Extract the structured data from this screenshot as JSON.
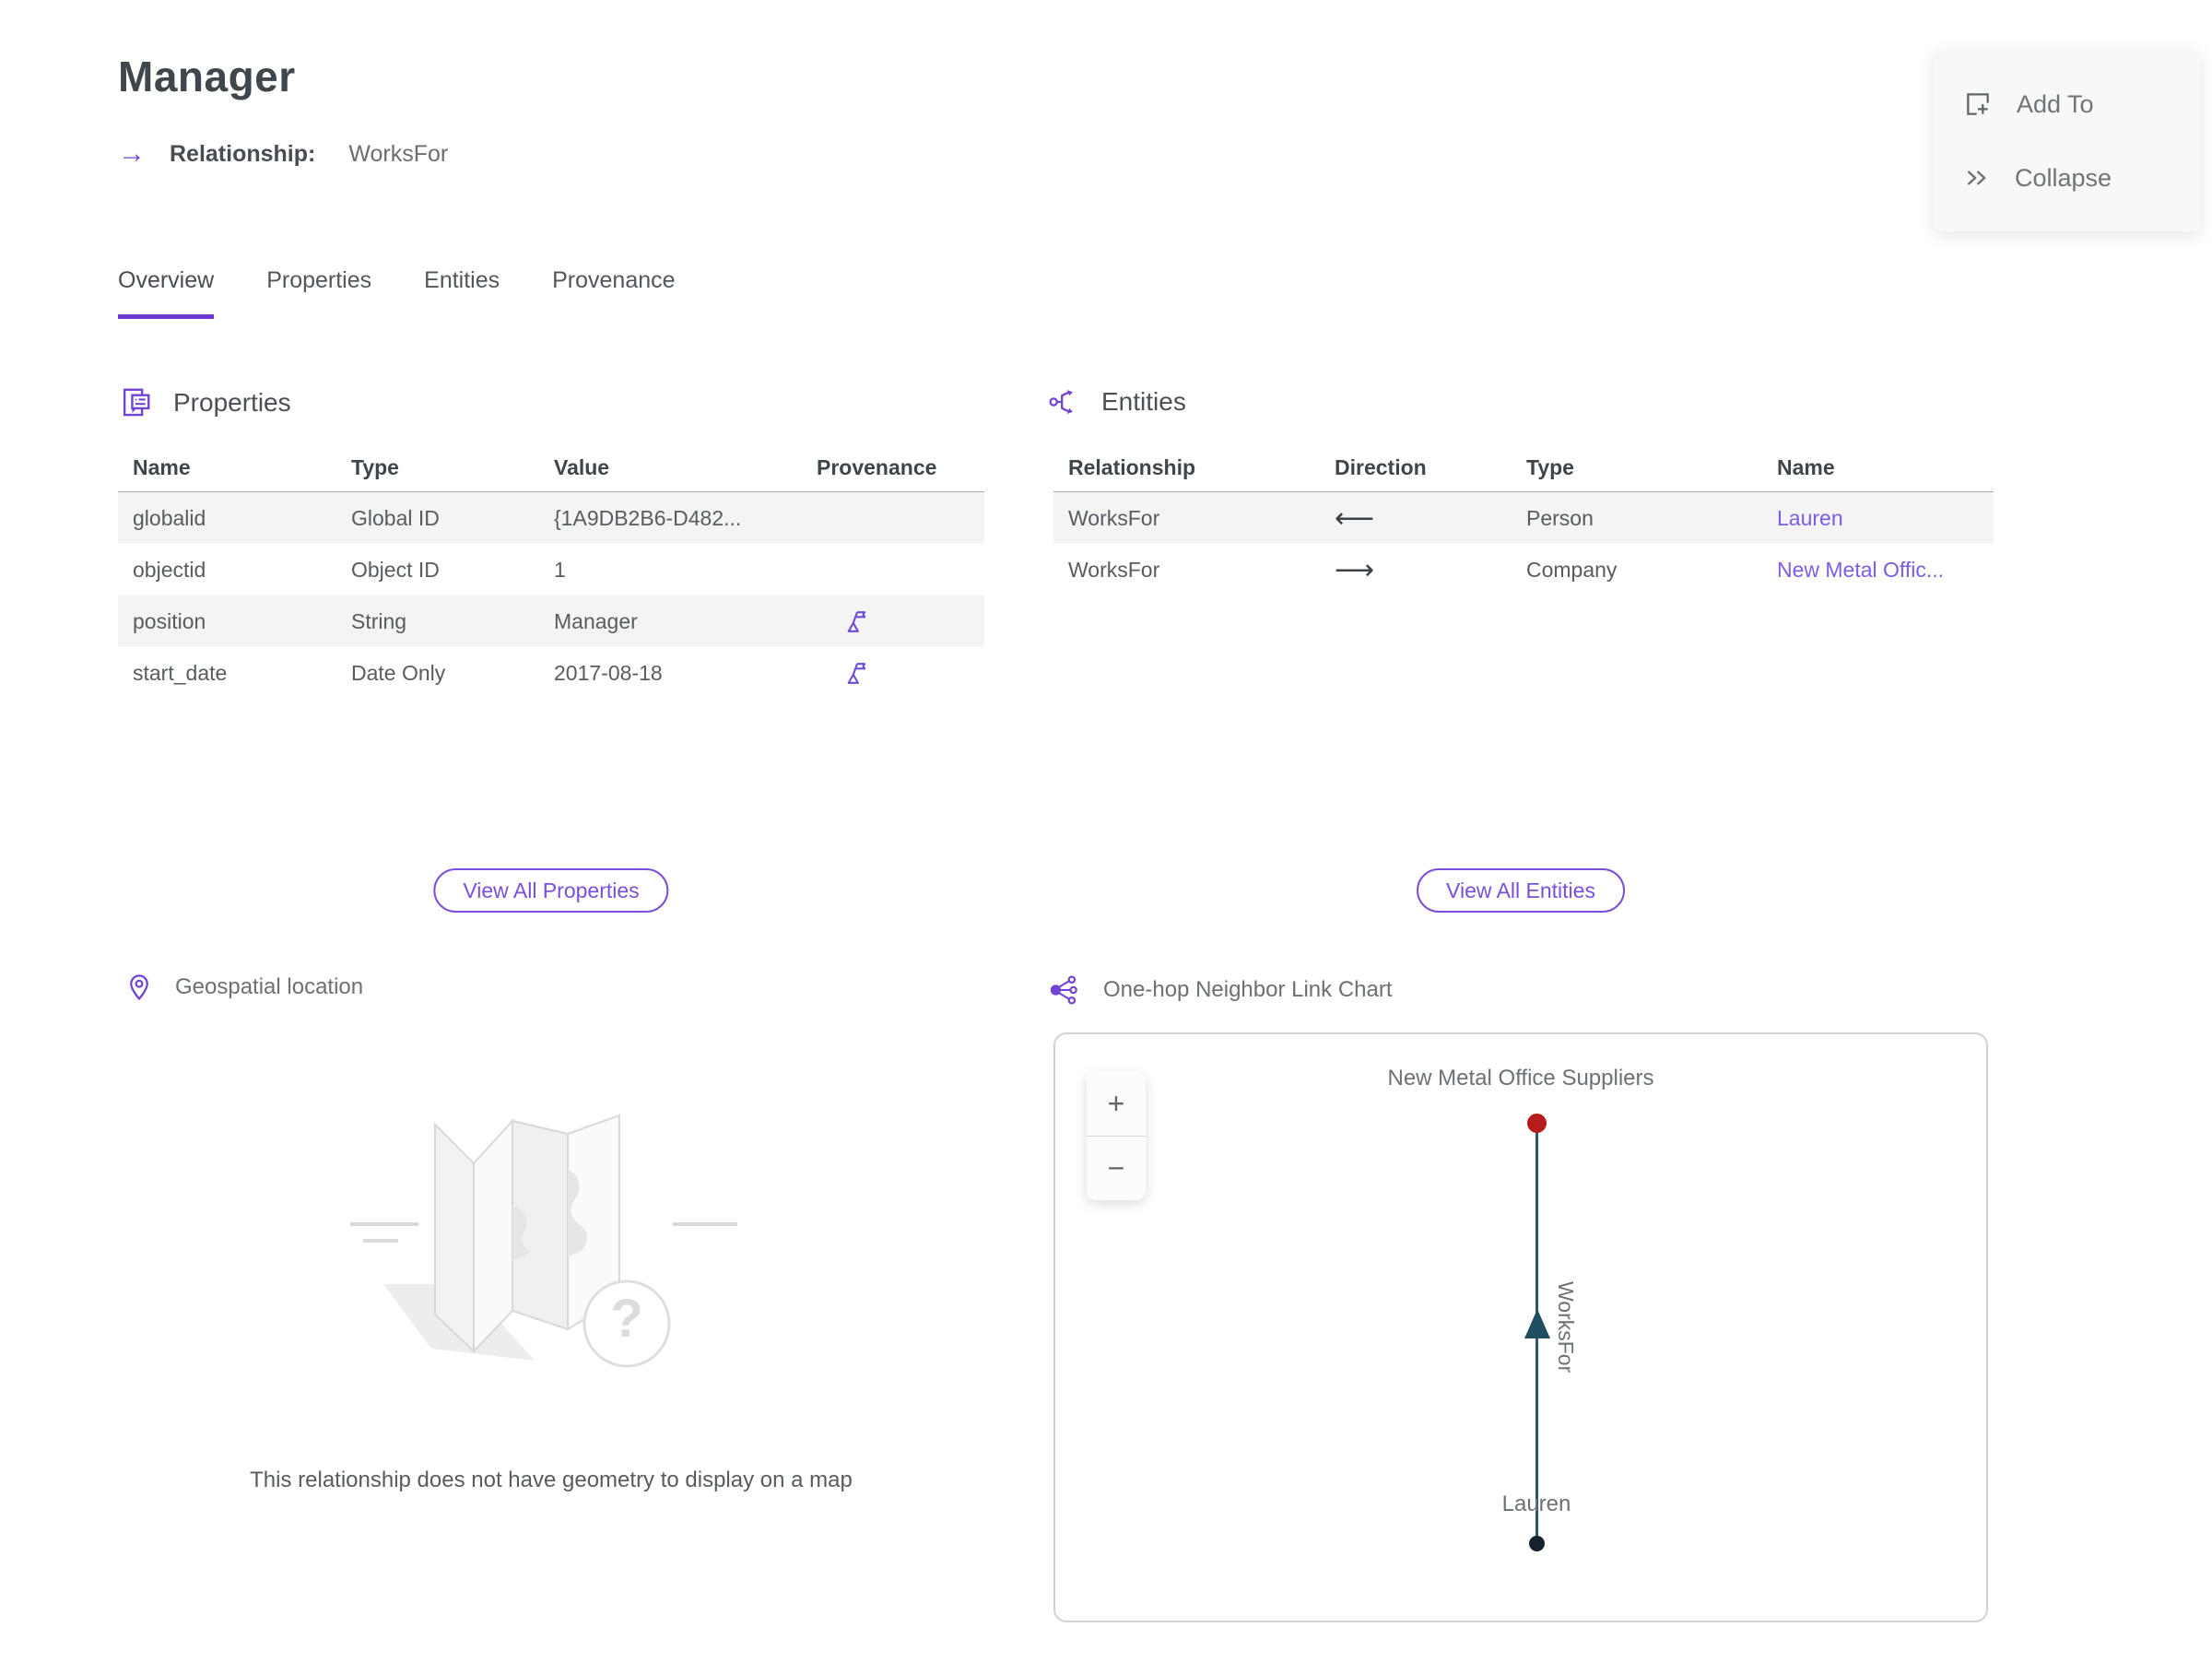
{
  "page": {
    "title": "Manager",
    "subtitle_label": "Relationship:",
    "subtitle_value": "WorksFor"
  },
  "actions": {
    "add_to": "Add To",
    "collapse": "Collapse"
  },
  "tabs": [
    {
      "label": "Overview",
      "active": true
    },
    {
      "label": "Properties",
      "active": false
    },
    {
      "label": "Entities",
      "active": false
    },
    {
      "label": "Provenance",
      "active": false
    }
  ],
  "properties_section": {
    "title": "Properties",
    "columns": [
      "Name",
      "Type",
      "Value",
      "Provenance"
    ],
    "rows": [
      {
        "name": "globalid",
        "type": "Global ID",
        "value": "{1A9DB2B6-D482...",
        "has_provenance": false
      },
      {
        "name": "objectid",
        "type": "Object ID",
        "value": "1",
        "has_provenance": false
      },
      {
        "name": "position",
        "type": "String",
        "value": "Manager",
        "has_provenance": true
      },
      {
        "name": "start_date",
        "type": "Date Only",
        "value": "2017-08-18",
        "has_provenance": true
      }
    ],
    "view_all_label": "View All Properties"
  },
  "entities_section": {
    "title": "Entities",
    "columns": [
      "Relationship",
      "Direction",
      "Type",
      "Name"
    ],
    "rows": [
      {
        "relationship": "WorksFor",
        "direction_glyph": "⟵",
        "type": "Person",
        "name": "Lauren"
      },
      {
        "relationship": "WorksFor",
        "direction_glyph": "⟶",
        "type": "Company",
        "name": "New Metal Offic..."
      }
    ],
    "view_all_label": "View All Entities"
  },
  "geospatial_section": {
    "title": "Geospatial location",
    "empty_message": "This relationship does not have geometry to display on a map"
  },
  "link_chart_section": {
    "title": "One-hop Neighbor Link Chart",
    "zoom_in_glyph": "+",
    "zoom_out_glyph": "−",
    "top_node_label": "New Metal Office Suppliers",
    "bottom_node_label": "Lauren",
    "edge_label": "WorksFor",
    "top_node_color": "#b51d1d",
    "bottom_node_color": "#16232e",
    "edge_color": "#29596a"
  },
  "icons": {
    "subtitle_arrow_glyph": "→",
    "accent_color": "#7142d6",
    "link_color": "#7d5ce0"
  }
}
